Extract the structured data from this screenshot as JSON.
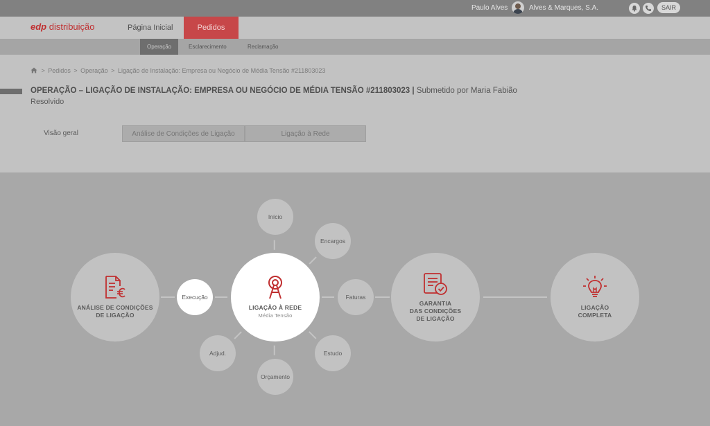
{
  "topbar": {
    "user_name": "Paulo Alves",
    "company": "Alves & Marques, S.A.",
    "logout_label": "SAIR"
  },
  "brand": {
    "prefix": "edp",
    "name": "distribuição"
  },
  "nav": {
    "items": [
      "Página Inicial",
      "Pedidos"
    ],
    "active": "Pedidos"
  },
  "subnav": {
    "items": [
      "Operação",
      "Esclarecimento",
      "Reclamação"
    ],
    "active": "Operação"
  },
  "breadcrumb": [
    ">",
    "Pedidos",
    ">",
    "Operação",
    ">",
    "Ligação de Instalação: Empresa ou Negócio de Média Tensão #211803023"
  ],
  "page": {
    "title": "OPERAÇÃO – LIGAÇÃO DE INSTALAÇÃO: EMPRESA OU NEGÓCIO DE MÉDIA TENSÃO #211803023",
    "separator": "|",
    "submitted_by": "Submetido por Maria Fabião",
    "status": "Resolvido"
  },
  "tabs": [
    "Visão geral",
    "Análise de Condições de Ligação",
    "Ligação à Rede"
  ],
  "diagram": {
    "stages": [
      {
        "line1": "ANÁLISE DE CONDIÇÕES",
        "line2": "DE LIGAÇÃO",
        "line3": ""
      },
      {
        "line1": "LIGAÇÃO À REDE",
        "line2": "Média Tensão",
        "line3": ""
      },
      {
        "line1": "GARANTIA",
        "line2": "DAS CONDIÇÕES",
        "line3": "DE LIGAÇÃO"
      },
      {
        "line1": "LIGAÇÃO",
        "line2": "COMPLETA",
        "line3": ""
      }
    ],
    "steps": {
      "inicio": "Início",
      "encargos": "Encargos",
      "faturas": "Faturas",
      "estudo": "Estudo",
      "orcamento": "Orçamento",
      "adjud": "Adjud.",
      "execucao": "Execução"
    }
  },
  "colors": {
    "brand_red": "#c02f30",
    "active_nav": "#c74749"
  }
}
